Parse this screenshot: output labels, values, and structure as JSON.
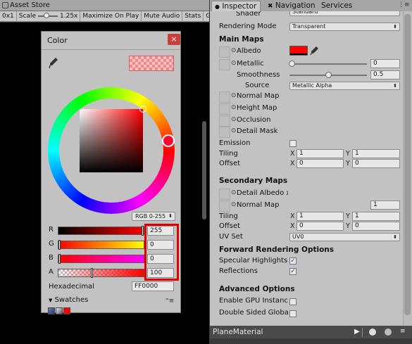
{
  "game": {
    "tab_label": "Asset Store",
    "toolbar": {
      "aspect": "0x1",
      "scale_label": "Scale",
      "scale_value": "1.25x",
      "maximize_on_play": "Maximize On Play",
      "mute_audio": "Mute Audio",
      "stats": "Stats",
      "gizmos": "Gizm"
    }
  },
  "color_picker": {
    "title": "Color",
    "close_glyph": "×",
    "mode": "RGB 0-255",
    "channels": [
      {
        "label": "R",
        "value": "255",
        "fill": 1.0
      },
      {
        "label": "G",
        "value": "0",
        "fill": 0.0
      },
      {
        "label": "B",
        "value": "0",
        "fill": 0.0
      },
      {
        "label": "A",
        "value": "100",
        "fill": 0.392
      }
    ],
    "hex_label": "Hexadecimal",
    "hex_value": "FF0000",
    "swatches_label": "Swatches",
    "menu_glyph": "⁼≡"
  },
  "inspector": {
    "tabs": [
      "Inspector",
      "Navigation",
      "Services"
    ],
    "shader_label": "Shader",
    "shader_value": "Standard",
    "rendering_mode_label": "Rendering Mode",
    "rendering_mode_value": "Transparent",
    "main_maps_header": "Main Maps",
    "albedo_label": "Albedo",
    "metallic_label": "Metallic",
    "metallic_value": "0",
    "smoothness_label": "Smoothness",
    "smoothness_value": "0.5",
    "source_label": "Source",
    "source_value": "Metallic Alpha",
    "normal_map_label": "Normal Map",
    "height_map_label": "Height Map",
    "occlusion_label": "Occlusion",
    "detail_mask_label": "Detail Mask",
    "emission_label": "Emission",
    "tiling_label": "Tiling",
    "offset_label": "Offset",
    "x_label": "X",
    "y_label": "Y",
    "main_tiling_x": "1",
    "main_tiling_y": "1",
    "main_offset_x": "0",
    "main_offset_y": "0",
    "secondary_maps_header": "Secondary Maps",
    "detail_albedo_label": "Detail Albedo x2",
    "sec_normal_map_label": "Normal Map",
    "sec_normal_value": "1",
    "sec_tiling_x": "1",
    "sec_tiling_y": "1",
    "sec_offset_x": "0",
    "sec_offset_y": "0",
    "uv_set_label": "UV Set",
    "uv_set_value": "UV0",
    "forward_header": "Forward Rendering Options",
    "specular_label": "Specular Highlights",
    "reflections_label": "Reflections",
    "advanced_header": "Advanced Options",
    "gpu_instancing_label": "Enable GPU Instancing",
    "double_sided_label": "Double Sided Global Illumination",
    "check_glyph": "✓",
    "dropdown_arrow": "⬍"
  },
  "preview": {
    "title": "PlaneMaterial",
    "play_glyph": "▶"
  },
  "colors": {
    "albedo": "#ff0000",
    "highlight_box": "#e00000",
    "window_bg": "#c2c2c2"
  }
}
